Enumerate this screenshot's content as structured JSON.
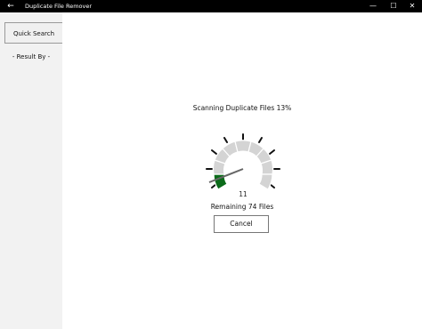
{
  "window": {
    "title": "Duplicate File Remover",
    "back_icon": "arrow-left-icon",
    "minimize": "—",
    "maximize": "☐",
    "close": "✕"
  },
  "sidebar": {
    "quick_search": "Quick Search",
    "result_by": "- Result By -"
  },
  "scan": {
    "status": "Scanning Duplicate Files 13%",
    "progress_percent": 13,
    "gauge_value": "11",
    "remaining": "Remaining 74 Files",
    "accent": "#0b6b1a"
  },
  "actions": {
    "cancel": "Cancel"
  }
}
